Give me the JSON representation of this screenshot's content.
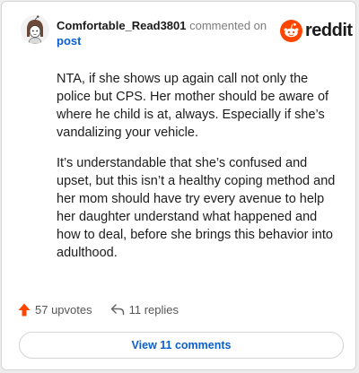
{
  "comment": {
    "username": "Comfortable_Read3801",
    "action_text": "commented on",
    "post_link": "post",
    "paragraphs": [
      "NTA, if she shows up again call not only the police but CPS. Her mother should be aware of where he child is at, always. Especially if she’s vandalizing your vehicle.",
      "It’s understandable that she’s confused and upset, but this isn’t a healthy coping method and her mom should have try every avenue to help her daughter understand what happened and how to deal, before she brings this behavior into adulthood."
    ]
  },
  "brand": {
    "wordmark": "reddit",
    "color": "#ff4500"
  },
  "actions": {
    "upvotes": "57 upvotes",
    "replies": "11 replies",
    "upvote_icon": "upvote-arrow-icon",
    "reply_icon": "reply-arrow-icon"
  },
  "view_comments": {
    "label": "View 11 comments",
    "color": "#0b5fd0"
  }
}
